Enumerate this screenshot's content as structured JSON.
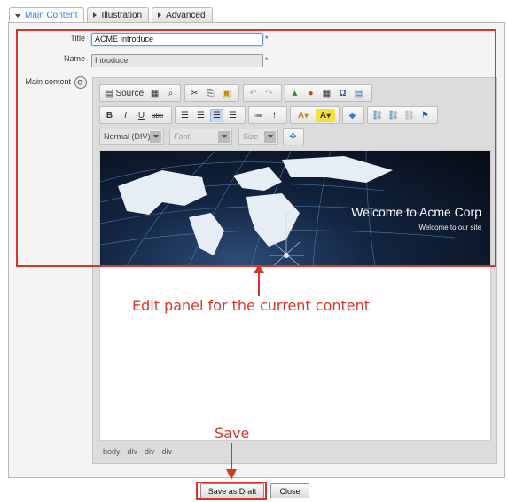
{
  "tabs": [
    {
      "label": "Main Content",
      "active": true
    },
    {
      "label": "Illustration",
      "active": false
    },
    {
      "label": "Advanced",
      "active": false
    }
  ],
  "form": {
    "title_label": "Title",
    "title_value": "ACME Introduce",
    "name_label": "Name",
    "name_value": "Introduce",
    "required_mark": "*",
    "main_content_label": "Main content"
  },
  "editor": {
    "source_label": "Source",
    "format_value": "Normal (DIV)",
    "font_placeholder": "Font",
    "size_placeholder": "Size",
    "banner_title": "Welcome to Acme Corp",
    "banner_subtitle": "Welcome to our site",
    "element_path": [
      "body",
      "div",
      "div",
      "div"
    ],
    "icons": [
      "document-icon",
      "templates-icon",
      "find-icon",
      "cut-icon",
      "copy-icon",
      "paste-icon",
      "undo-icon",
      "redo-icon",
      "image-icon",
      "flash-icon",
      "table-icon",
      "special-char-icon",
      "iframe-icon",
      "bold-icon",
      "italic-icon",
      "underline-icon",
      "strikethrough-icon",
      "align-left-icon",
      "align-center-icon",
      "align-right-icon",
      "justify-icon",
      "numbered-list-icon",
      "bulleted-list-icon",
      "text-color-icon",
      "bg-color-icon",
      "remove-format-icon",
      "link-icon",
      "unlink-icon",
      "image-link-icon",
      "anchor-icon",
      "maximize-icon"
    ],
    "active_alignment": "align-right"
  },
  "annotations": {
    "edit_panel_note": "Edit panel for the current content",
    "save_note": "Save",
    "color": "#d9362b"
  },
  "buttons": {
    "save_draft": "Save as Draft",
    "close": "Close"
  }
}
